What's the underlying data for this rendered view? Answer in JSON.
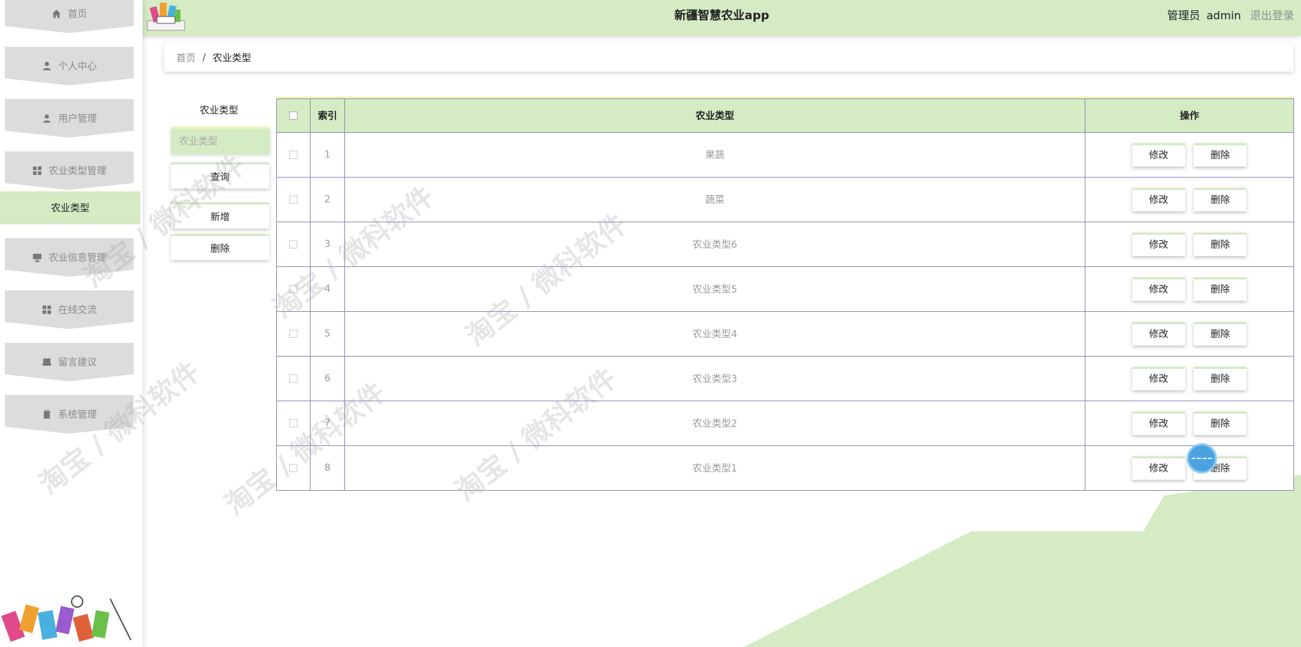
{
  "app": {
    "title": "新疆智慧农业app"
  },
  "user": {
    "role": "管理员",
    "name": "admin",
    "logout": "退出登录"
  },
  "sidebar": {
    "items": [
      {
        "label": "首页",
        "icon": "home-icon"
      },
      {
        "label": "个人中心",
        "icon": "person-icon"
      },
      {
        "label": "用户管理",
        "icon": "user-icon"
      },
      {
        "label": "农业类型管理",
        "icon": "grid-icon"
      },
      {
        "label": "农业信息管理",
        "icon": "monitor-icon"
      },
      {
        "label": "在线交流",
        "icon": "grid-icon"
      },
      {
        "label": "留言建议",
        "icon": "inbox-icon"
      },
      {
        "label": "系统管理",
        "icon": "clipboard-icon"
      }
    ],
    "active_sub": "农业类型"
  },
  "breadcrumb": {
    "home": "首页",
    "separator": "/",
    "current": "农业类型"
  },
  "search": {
    "label": "农业类型",
    "placeholder": "农业类型",
    "query_button": "查询",
    "add_button": "新增",
    "delete_button": "删除"
  },
  "table": {
    "headers": {
      "index": "索引",
      "type": "农业类型",
      "actions": "操作"
    },
    "edit_label": "修改",
    "delete_label": "删除",
    "rows": [
      {
        "index": "1",
        "type": "果蔬"
      },
      {
        "index": "2",
        "type": "蔬菜"
      },
      {
        "index": "3",
        "type": "农业类型6"
      },
      {
        "index": "4",
        "type": "农业类型5"
      },
      {
        "index": "5",
        "type": "农业类型4"
      },
      {
        "index": "6",
        "type": "农业类型3"
      },
      {
        "index": "7",
        "type": "农业类型2"
      },
      {
        "index": "8",
        "type": "农业类型1"
      }
    ]
  },
  "watermark": {
    "text": "淘宝 / 微科软件"
  },
  "colors": {
    "accent_green": "#d4ebc4",
    "accent_yellow": "#f3f3b8",
    "border": "#8b8bb0"
  }
}
